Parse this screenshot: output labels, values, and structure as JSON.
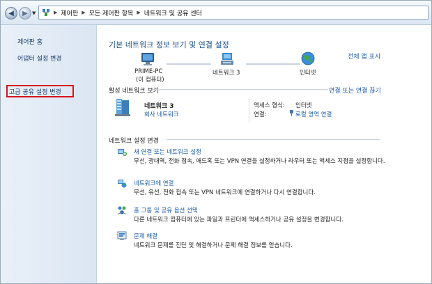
{
  "address_bar": {
    "breadcrumbs": [
      "제어판",
      "모든 제어판 항목",
      "네트워크 및 공유 센터"
    ]
  },
  "sidebar": {
    "items": [
      {
        "label": "제어판 홈"
      },
      {
        "label": "어댑터 설정 변경"
      },
      {
        "label": "고급 공유 설정 변경",
        "highlighted": true
      }
    ],
    "highlight_color": "#d6141c"
  },
  "main": {
    "title": "기본 네트워크 정보 보기 및 연결 설정",
    "full_map_link": "전체 맵 표시",
    "map": {
      "pc_name": "PRIME-PC",
      "pc_sub": "(이 컴퓨터)",
      "network_name": "네트워크  3",
      "internet": "인터넷"
    },
    "active": {
      "header": "활성 네트워크 보기",
      "connect_link": "연결 또는 연결 끊기",
      "network_name": "네트워크  3",
      "network_type": "회사 네트워크",
      "access_type_label": "액세스 형식:",
      "access_type_value": "인터넷",
      "connections_label": "연결:",
      "connections_value": "로컬 영역 연결"
    },
    "settings": {
      "header": "네트워크 설정 변경",
      "items": [
        {
          "title": "새 연결 또는 네트워크 설정",
          "desc": "무선, 광대역, 전화 접속, 애드혹 또는 VPN 연결을 설정하거나 라우터 또는 액세스 지점을 설정합니다.",
          "icon": "new-connection-icon"
        },
        {
          "title": "네트워크에 연결",
          "desc": "무선, 유선, 전화 접속 또는 VPN 네트워크에 연결하거나 다시 연결합니다.",
          "icon": "connect-network-icon"
        },
        {
          "title": "홈 그룹 및 공유 옵션 선택",
          "desc": "다른 네트워크 컴퓨터에 있는 파일과 프린터에 액세스하거나 공유 설정을 변경합니다.",
          "icon": "homegroup-icon"
        },
        {
          "title": "문제 해결",
          "desc": "네트워크 문제를 진단 및 해결하거나 문제 해결 정보를 얻습니다.",
          "icon": "troubleshoot-icon"
        }
      ]
    }
  }
}
